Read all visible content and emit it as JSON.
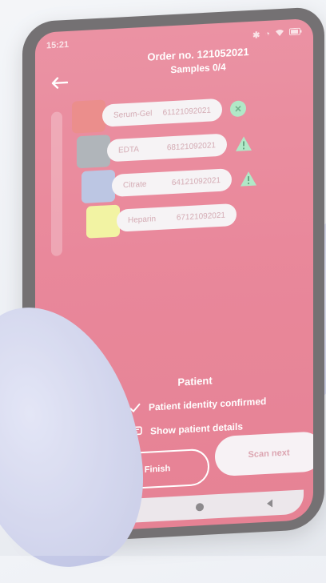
{
  "statusbar": {
    "time": "15:21"
  },
  "header": {
    "order": "Order no. 12105202​1",
    "samples": "Samples 0/4"
  },
  "samples": [
    {
      "name": "Serum-Gel",
      "code": "61121092021",
      "color": "#e66f6c",
      "status": "ok"
    },
    {
      "name": "EDTA",
      "code": "68121092021",
      "color": "#9aa0a7",
      "status": "warning"
    },
    {
      "name": "Citrate",
      "code": "64121092021",
      "color": "#a9b7dc",
      "status": "warning"
    },
    {
      "name": "Heparin",
      "code": "67121092021",
      "color": "#eff08a",
      "status": "none"
    }
  ],
  "patient": {
    "title": "Patient",
    "identity": "Patient identity confirmed",
    "details": "Show patient details"
  },
  "buttons": {
    "finish": "Finish",
    "scan_next": "Scan next"
  },
  "colors": {
    "screen": "#e3677f",
    "ok": "#9be2b8",
    "warn": "#9be2b8"
  }
}
